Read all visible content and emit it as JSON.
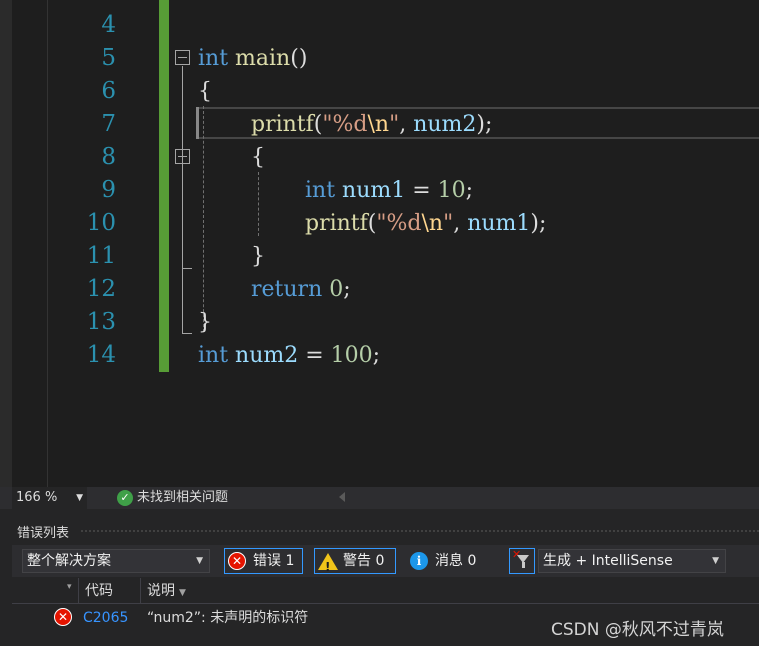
{
  "editor": {
    "lines": [
      {
        "num": "4"
      },
      {
        "num": "5"
      },
      {
        "num": "6"
      },
      {
        "num": "7"
      },
      {
        "num": "8"
      },
      {
        "num": "9"
      },
      {
        "num": "10"
      },
      {
        "num": "11"
      },
      {
        "num": "12"
      },
      {
        "num": "13"
      },
      {
        "num": "14"
      }
    ],
    "tokens": {
      "l5_kw": "int",
      "l5_fn": "main",
      "l5_par": "()",
      "l6_brace": "{",
      "l7_fn": "printf",
      "l7_open": "(",
      "l7_str1": "\"%d",
      "l7_esc": "\\n",
      "l7_str2": "\"",
      "l7_comma": ", ",
      "l7_var": "num2",
      "l7_close": ");",
      "l8_brace": "{",
      "l9_kw": "int",
      "l9_var": "num1",
      "l9_eq": " = ",
      "l9_num": "10",
      "l9_semi": ";",
      "l10_fn": "printf",
      "l10_open": "(",
      "l10_str1": "\"%d",
      "l10_esc": "\\n",
      "l10_str2": "\"",
      "l10_comma": ", ",
      "l10_var": "num1",
      "l10_close": ");",
      "l11_brace": "}",
      "l12_kw": "return",
      "l12_num": "0",
      "l12_semi": ";",
      "l13_brace": "}",
      "l14_kw": "int",
      "l14_var": "num2",
      "l14_eq": " = ",
      "l14_num": "100",
      "l14_semi": ";"
    }
  },
  "status": {
    "zoom": "166 %",
    "issues_text": "未找到相关问题"
  },
  "error_list": {
    "title": "错误列表",
    "scope": "整个解决方案",
    "errors_label": "错误 1",
    "warnings_label": "警告 0",
    "messages_label": "消息 0",
    "source": "生成 + IntelliSense",
    "columns": {
      "code": "代码",
      "description": "说明"
    },
    "rows": [
      {
        "code": "C2065",
        "description": "“num2”: 未声明的标识符"
      }
    ]
  },
  "watermark": "CSDN @秋风不过青岚",
  "colors": {
    "keyword": "#569cd6",
    "function": "#dcdcaa",
    "string": "#d69d85",
    "number": "#b5cea8",
    "variable": "#9cdcfe",
    "line_number": "#2b91af",
    "change_bar": "#579c36",
    "error": "#e51400",
    "link": "#3794ff"
  },
  "icons": [
    "fold-collapse-icon",
    "check-circle-icon",
    "error-icon",
    "warning-icon",
    "info-icon",
    "filter-clear-icon",
    "dropdown-arrow-icon"
  ]
}
